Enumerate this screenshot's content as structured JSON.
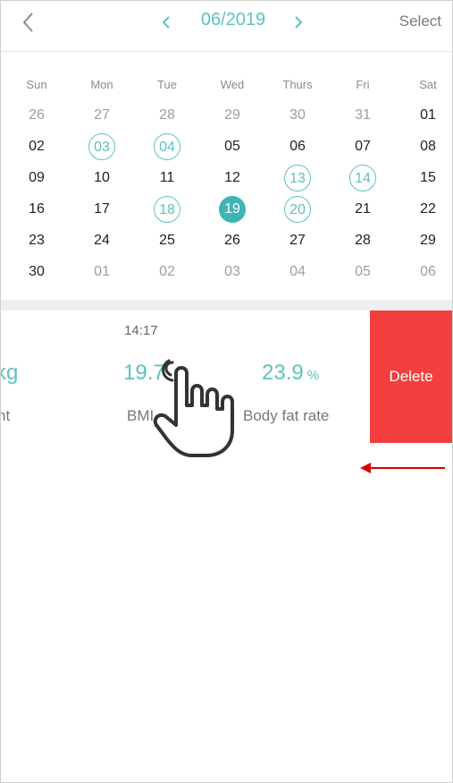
{
  "header": {
    "month_label": "06/2019",
    "select_label": "Select",
    "icons": [
      "back-chevron-icon",
      "chevron-left-icon",
      "chevron-right-icon"
    ]
  },
  "calendar": {
    "weekdays": [
      "Sun",
      "Mon",
      "Tue",
      "Wed",
      "Thurs",
      "Fri",
      "Sat"
    ],
    "weeks": [
      [
        {
          "d": "26",
          "t": "out"
        },
        {
          "d": "27",
          "t": "out"
        },
        {
          "d": "28",
          "t": "out"
        },
        {
          "d": "29",
          "t": "out"
        },
        {
          "d": "30",
          "t": "out"
        },
        {
          "d": "31",
          "t": "out"
        },
        {
          "d": "01",
          "t": "in"
        }
      ],
      [
        {
          "d": "02",
          "t": "in"
        },
        {
          "d": "03",
          "t": "record"
        },
        {
          "d": "04",
          "t": "record"
        },
        {
          "d": "05",
          "t": "in"
        },
        {
          "d": "06",
          "t": "in"
        },
        {
          "d": "07",
          "t": "in"
        },
        {
          "d": "08",
          "t": "in"
        }
      ],
      [
        {
          "d": "09",
          "t": "in"
        },
        {
          "d": "10",
          "t": "in"
        },
        {
          "d": "11",
          "t": "in"
        },
        {
          "d": "12",
          "t": "in"
        },
        {
          "d": "13",
          "t": "record"
        },
        {
          "d": "14",
          "t": "record"
        },
        {
          "d": "15",
          "t": "in"
        }
      ],
      [
        {
          "d": "16",
          "t": "in"
        },
        {
          "d": "17",
          "t": "in"
        },
        {
          "d": "18",
          "t": "record"
        },
        {
          "d": "19",
          "t": "selected"
        },
        {
          "d": "20",
          "t": "record"
        },
        {
          "d": "21",
          "t": "in"
        },
        {
          "d": "22",
          "t": "in"
        }
      ],
      [
        {
          "d": "23",
          "t": "in"
        },
        {
          "d": "24",
          "t": "in"
        },
        {
          "d": "25",
          "t": "in"
        },
        {
          "d": "26",
          "t": "in"
        },
        {
          "d": "27",
          "t": "in"
        },
        {
          "d": "28",
          "t": "in"
        },
        {
          "d": "29",
          "t": "in"
        }
      ],
      [
        {
          "d": "30",
          "t": "in"
        },
        {
          "d": "01",
          "t": "out"
        },
        {
          "d": "02",
          "t": "out"
        },
        {
          "d": "03",
          "t": "out"
        },
        {
          "d": "04",
          "t": "out"
        },
        {
          "d": "05",
          "t": "out"
        },
        {
          "d": "06",
          "t": "out"
        }
      ]
    ]
  },
  "record": {
    "time": "14:17",
    "weight_unit": "kg",
    "weight_label": "ht",
    "bmi_value": "19.7",
    "bmi_label": "BMI",
    "body_fat_value": "23.9",
    "body_fat_unit": "%",
    "body_fat_label": "Body fat rate",
    "delete_label": "Delete"
  },
  "annotations": {
    "icons": [
      "pointing-hand-icon",
      "swipe-left-arrow-icon"
    ],
    "arrow_color": "#e00000"
  },
  "colors": {
    "accent": "#5fc1c0",
    "selected_day": "#3db5b3",
    "delete": "#f3403e"
  }
}
